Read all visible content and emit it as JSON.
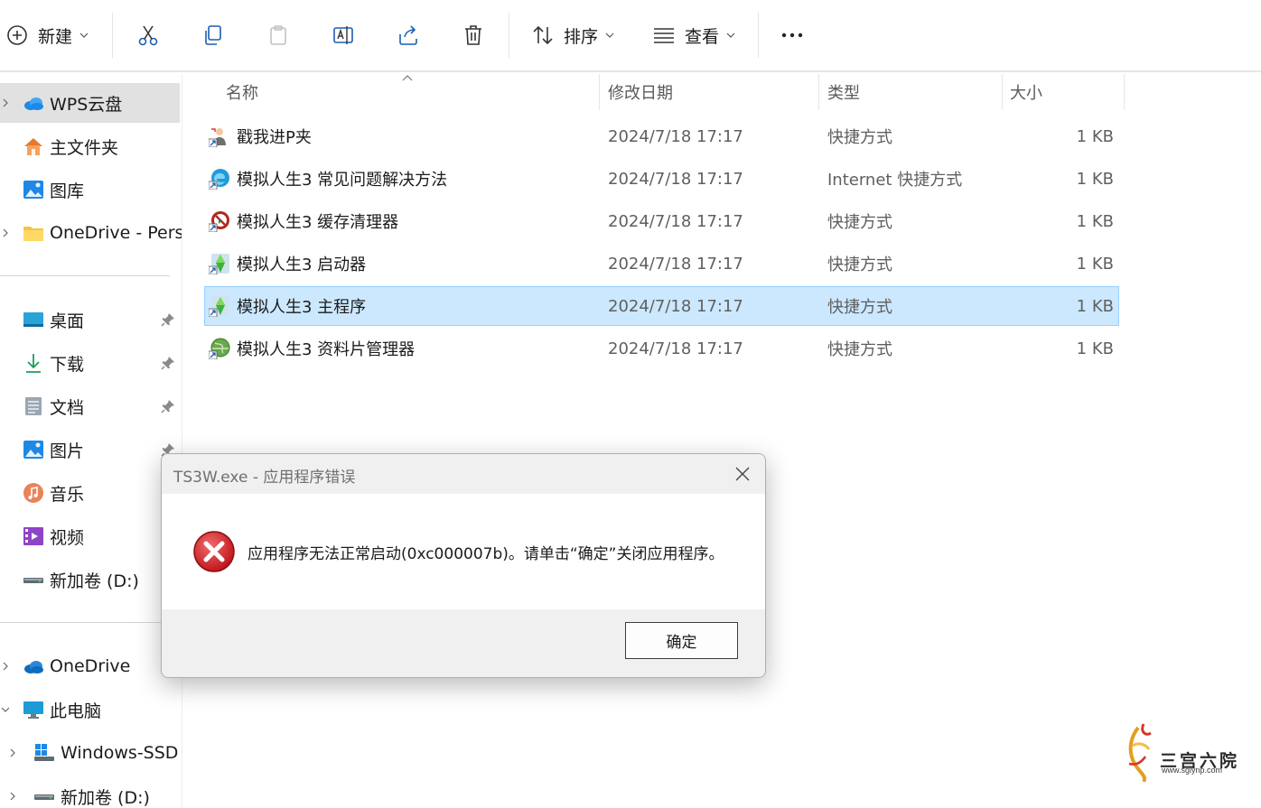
{
  "toolbar": {
    "new_label": "新建",
    "sort_label": "排序",
    "view_label": "查看"
  },
  "sidebar": {
    "items": [
      {
        "label": "WPS云盘",
        "icon": "cloud-icon"
      },
      {
        "label": "主文件夹",
        "icon": "home-icon"
      },
      {
        "label": "图库",
        "icon": "gallery-icon"
      },
      {
        "label": "OneDrive - Perso",
        "icon": "folder-icon"
      },
      {
        "label": "桌面",
        "icon": "desktop-icon"
      },
      {
        "label": "下载",
        "icon": "download-icon"
      },
      {
        "label": "文档",
        "icon": "document-icon"
      },
      {
        "label": "图片",
        "icon": "pictures-icon"
      },
      {
        "label": "音乐",
        "icon": "music-icon"
      },
      {
        "label": "视频",
        "icon": "video-icon"
      },
      {
        "label": "新加卷 (D:)",
        "icon": "drive-icon"
      },
      {
        "label": "OneDrive",
        "icon": "onedrive-icon"
      },
      {
        "label": "此电脑",
        "icon": "computer-icon"
      },
      {
        "label": "Windows-SSD (",
        "icon": "windows-drive-icon"
      },
      {
        "label": "新加卷 (D:)",
        "icon": "drive-icon"
      }
    ]
  },
  "columns": {
    "name": "名称",
    "date": "修改日期",
    "type": "类型",
    "size": "大小"
  },
  "files": [
    {
      "name": "戳我进P夹",
      "date": "2024/7/18 17:17",
      "type": "快捷方式",
      "size": "1 KB"
    },
    {
      "name": "模拟人生3 常见问题解决方法",
      "date": "2024/7/18 17:17",
      "type": "Internet 快捷方式",
      "size": "1 KB"
    },
    {
      "name": "模拟人生3 缓存清理器",
      "date": "2024/7/18 17:17",
      "type": "快捷方式",
      "size": "1 KB"
    },
    {
      "name": "模拟人生3 启动器",
      "date": "2024/7/18 17:17",
      "type": "快捷方式",
      "size": "1 KB"
    },
    {
      "name": "模拟人生3 主程序",
      "date": "2024/7/18 17:17",
      "type": "快捷方式",
      "size": "1 KB"
    },
    {
      "name": "模拟人生3 资料片管理器",
      "date": "2024/7/18 17:17",
      "type": "快捷方式",
      "size": "1 KB"
    }
  ],
  "dialog": {
    "title": "TS3W.exe - 应用程序错误",
    "message": "应用程序无法正常启动(0xc000007b)。请单击“确定”关闭应用程序。",
    "ok_label": "确定"
  },
  "watermark": {
    "text": "三宫六院",
    "url": "www.sglynp.com"
  },
  "colors": {
    "selection_bg": "#cce8ff",
    "selection_border": "#99d1ff",
    "error_red": "#d3222a",
    "accent_blue": "#0067c0"
  }
}
